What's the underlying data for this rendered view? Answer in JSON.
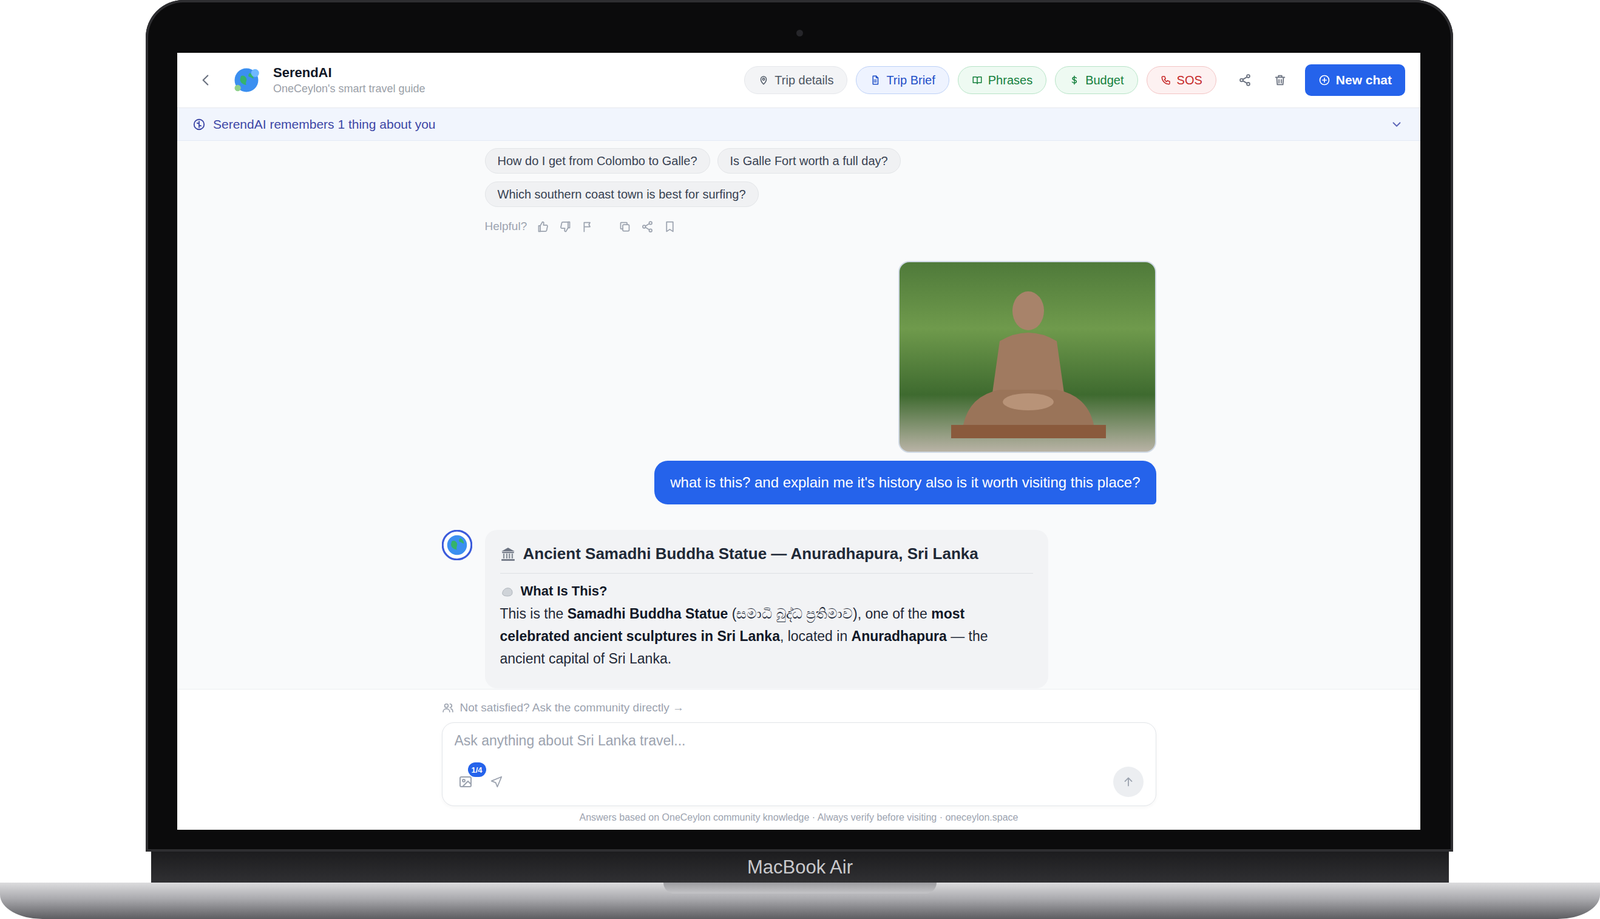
{
  "header": {
    "title": "SerendAI",
    "subtitle": "OneCeylon's smart travel guide",
    "actions": [
      {
        "label": "Trip details",
        "kind": "neutral"
      },
      {
        "label": "Trip Brief",
        "kind": "blue"
      },
      {
        "label": "Phrases",
        "kind": "green"
      },
      {
        "label": "Budget",
        "kind": "green"
      },
      {
        "label": "SOS",
        "kind": "red"
      }
    ],
    "new_chat": "New chat"
  },
  "memory_bar": {
    "text": "SerendAI remembers 1 thing about you",
    "expanded": false
  },
  "suggestions": [
    "How do I get from Colombo to Galle?",
    "Is Galle Fort worth a full day?",
    "Which southern coast town is best for surfing?"
  ],
  "feedback": {
    "label": "Helpful?"
  },
  "user_message": {
    "text": "what is this? and explain me it's history also is it worth visiting this place?"
  },
  "assistant_message": {
    "title": "Ancient Samadhi Buddha Statue — Anuradhapura, Sri Lanka",
    "section": "What Is This?",
    "paragraph": [
      {
        "text": "This is the ",
        "bold": false
      },
      {
        "text": "Samadhi Buddha Statue",
        "bold": true
      },
      {
        "text": " (සමාධි බුද්ධ ප්‍රතිමාව), one of the ",
        "bold": false
      },
      {
        "text": "most celebrated ancient sculptures in Sri Lanka",
        "bold": true
      },
      {
        "text": ", located in ",
        "bold": false
      },
      {
        "text": "Anuradhapura",
        "bold": true
      },
      {
        "text": " — the ancient capital of Sri Lanka.",
        "bold": false
      }
    ]
  },
  "composer": {
    "community_link": "Not satisfied? Ask the community directly →",
    "placeholder": "Ask anything about Sri Lanka travel...",
    "image_count": "1/4"
  },
  "footer": "Answers based on OneCeylon community knowledge · Always verify before visiting · oneceylon.space",
  "device": {
    "label": "MacBook Air"
  }
}
